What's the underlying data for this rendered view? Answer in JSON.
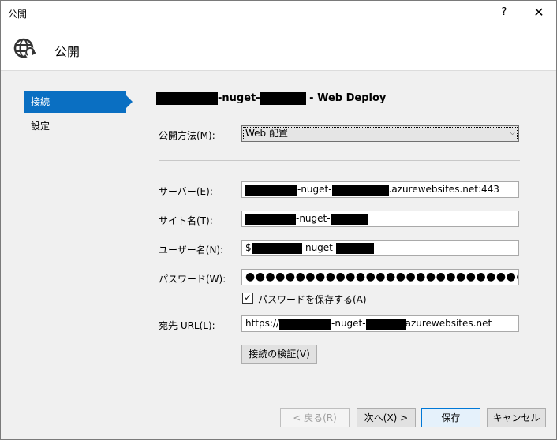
{
  "window": {
    "title": "公開",
    "help_label": "?",
    "close_label": "✕"
  },
  "header": {
    "title": "公開",
    "icon": "globe-publish-icon"
  },
  "sidebar": {
    "items": [
      {
        "label": "接続",
        "active": true
      },
      {
        "label": "設定",
        "active": false
      }
    ]
  },
  "main": {
    "heading_mid": "-nuget-",
    "heading_suffix": " - Web Deploy",
    "publish_method": {
      "label": "公開方法(M):",
      "value": "Web 配置"
    },
    "server": {
      "label": "サーバー(E):",
      "mid": "-nuget-",
      "suffix": ".azurewebsites.net:443"
    },
    "site_name": {
      "label": "サイト名(T):",
      "mid": "-nuget-"
    },
    "user_name": {
      "label": "ユーザー名(N):",
      "prefix": "$",
      "mid": "-nuget-"
    },
    "password": {
      "label": "パスワード(W):",
      "value": "●●●●●●●●●●●●●●●●●●●●●●●●●●●●●●"
    },
    "save_password": {
      "label": "パスワードを保存する(A)",
      "checked": true
    },
    "dest_url": {
      "label": "宛先 URL(L):",
      "prefix": "https://",
      "mid": "-nuget-",
      "suffix": "azurewebsites.net"
    },
    "validate_button": "接続の検証(V)"
  },
  "footer": {
    "back": "< 戻る(R)",
    "next": "次へ(X) >",
    "save": "保存",
    "cancel": "キャンセル"
  },
  "colors": {
    "accent": "#0a6fc2",
    "redaction": "#000000"
  }
}
